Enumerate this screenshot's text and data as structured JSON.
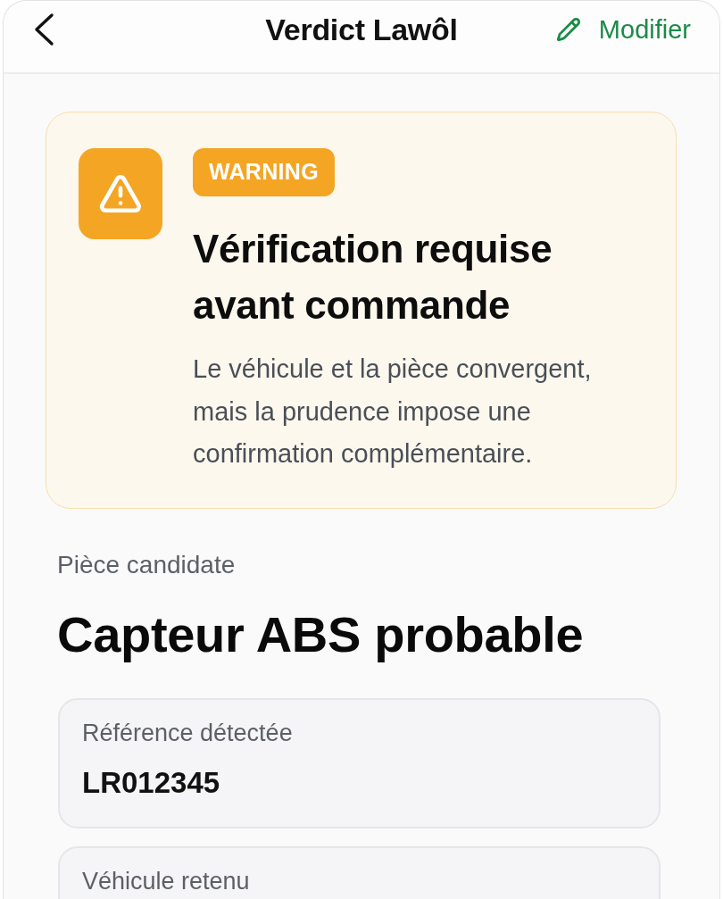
{
  "header": {
    "title": "Verdict Lawôl",
    "edit_label": "Modifier"
  },
  "alert": {
    "kind": "warning",
    "badge": "WARNING",
    "title": "Vérification requise avant commande",
    "message": "Le véhicule et la pièce convergent, mais la prudence impose une confirmation complémentaire."
  },
  "part": {
    "label": "Pièce candidate",
    "name": "Capteur ABS probable"
  },
  "fields": [
    {
      "label": "Référence détectée",
      "value": "LR012345"
    },
    {
      "label": "Véhicule retenu"
    }
  ]
}
